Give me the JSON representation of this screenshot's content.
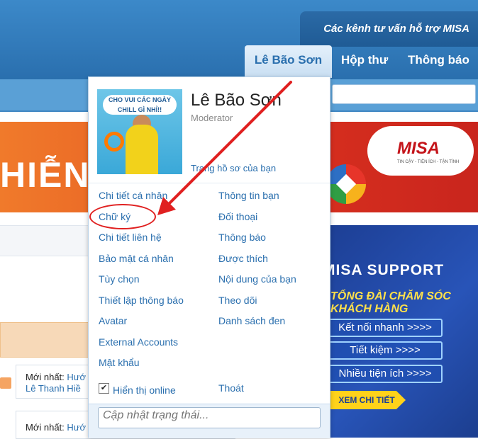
{
  "header": {
    "support_label": "Các kênh tư vấn hỗ trợ MISA",
    "nav": {
      "user_tab": "Lê Bão Sơn",
      "inbox": "Hộp thư",
      "notifications": "Thông báo"
    }
  },
  "banner": {
    "text": "HIỄN",
    "brand": "MISA",
    "brand_tagline": "TIN CẬY - TIỆN ÍCH - TẬN TÌNH"
  },
  "ad": {
    "title": "MISA SUPPORT",
    "subtitle": "TỔNG ĐÀI CHĂM SÓC KHÁCH HÀNG",
    "buttons": [
      "Kết nối nhanh >>>>",
      "Tiết kiệm >>>>",
      "Nhiều tiện ích >>>>"
    ],
    "cta": "XEM CHI TIẾT"
  },
  "feed": {
    "item1": {
      "prefix": "Mới nhất:",
      "link": "Hướ",
      "author": "Lê Thanh Hiề"
    },
    "item2": {
      "prefix": "Mới nhất:",
      "link": "Hướ"
    }
  },
  "user_menu": {
    "avatar_caption": "CHO VUI CÁC NGÀY CHILL GÌ NHỈ!!",
    "name": "Lê Bão Sơn",
    "role": "Moderator",
    "profile_link": "Trang hồ sơ của bạn",
    "left_items": [
      "Chi tiết cá nhân",
      "Chữ ký",
      "Chi tiết liên hệ",
      "Bảo mật cá nhân",
      "Tùy chọn",
      "Thiết lập thông báo",
      "Avatar",
      "External Accounts",
      "Mật khẩu"
    ],
    "right_items": [
      "Thông tin bạn",
      "Đối thoại",
      "Thông báo",
      "Được thích",
      "Nội dung của bạn",
      "Theo dõi",
      "Danh sách đen"
    ],
    "show_online": "Hiển thị online",
    "logout": "Thoát",
    "status_placeholder": "Cập nhật trạng thái..."
  },
  "colors": {
    "header_blue": "#2a6fae",
    "link_blue": "#2a6fae",
    "annotation_red": "#e02020"
  }
}
